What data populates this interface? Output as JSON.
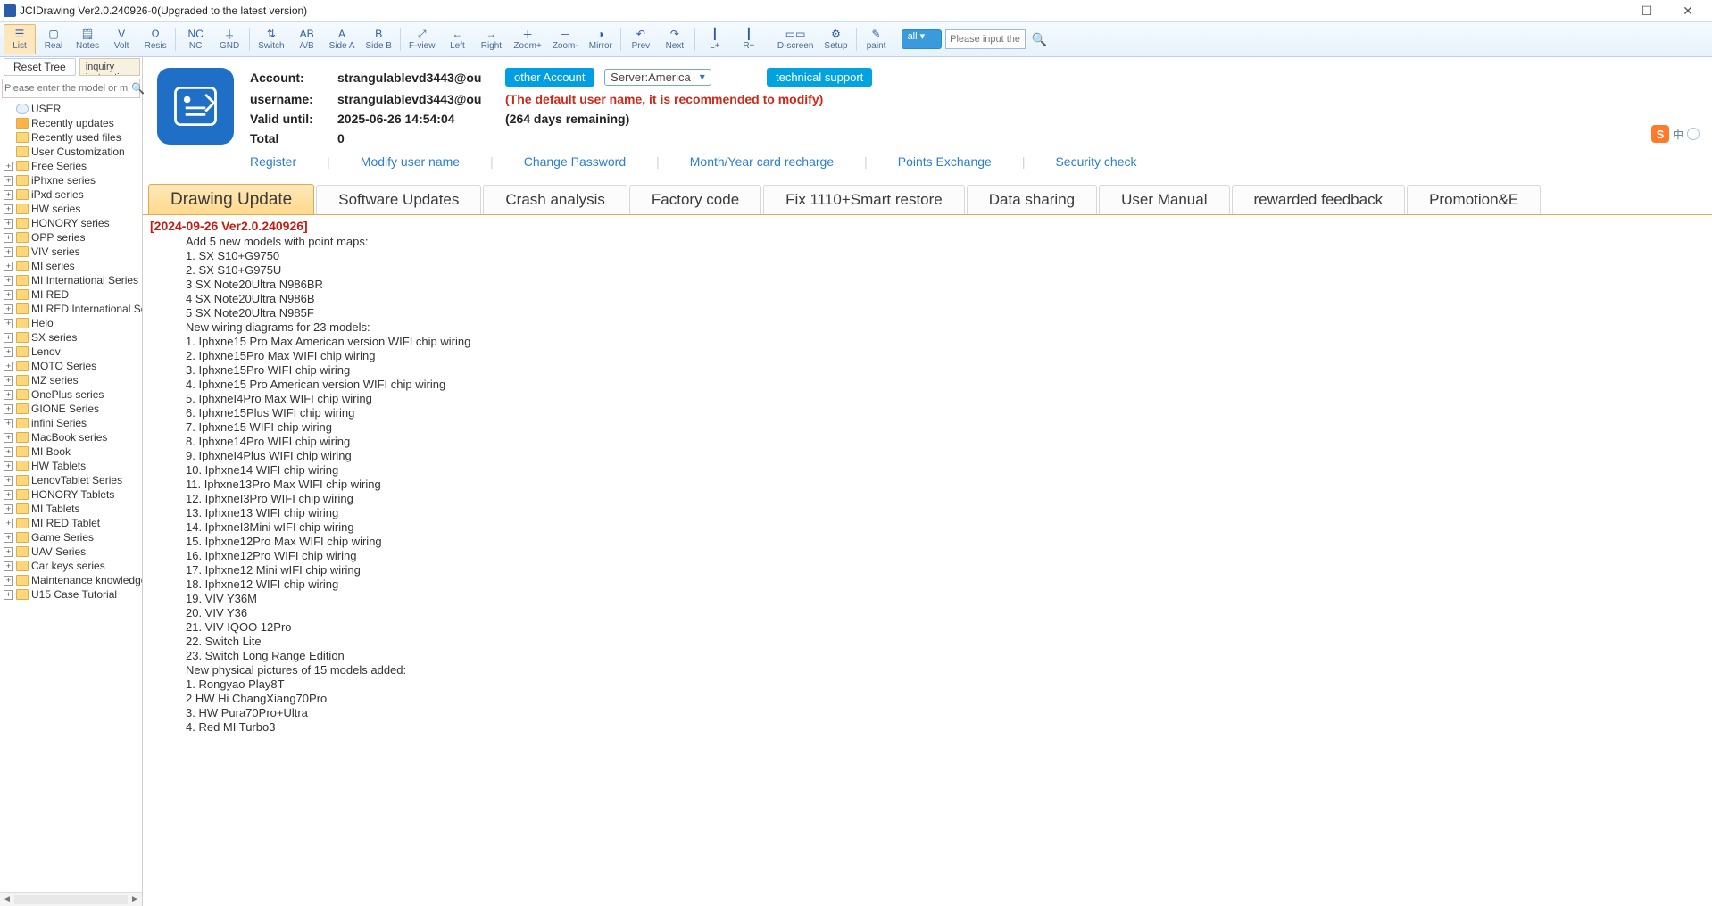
{
  "title": "JCIDrawing Ver2.0.240926-0(Upgraded to the latest version)",
  "toolbar": [
    {
      "id": "list",
      "label": "List",
      "active": true,
      "glyph": "☰"
    },
    {
      "id": "real",
      "label": "Real",
      "glyph": "▢"
    },
    {
      "id": "notes",
      "label": "Notes",
      "glyph": "🗒"
    },
    {
      "id": "volt",
      "label": "Volt",
      "glyph": "V"
    },
    {
      "id": "resis",
      "label": "Resis",
      "glyph": "Ω"
    },
    {
      "sep": true
    },
    {
      "id": "nc",
      "label": "NC",
      "glyph": "NC"
    },
    {
      "id": "gnd",
      "label": "GND",
      "glyph": "⏚"
    },
    {
      "sep": true
    },
    {
      "id": "switch",
      "label": "Switch",
      "glyph": "⇅"
    },
    {
      "id": "ab",
      "label": "A/B",
      "glyph": "AB"
    },
    {
      "id": "sidea",
      "label": "Side A",
      "glyph": "A"
    },
    {
      "id": "sideb",
      "label": "Side B",
      "glyph": "B"
    },
    {
      "sep": true
    },
    {
      "id": "fview",
      "label": "F-view",
      "glyph": "⤢"
    },
    {
      "id": "left",
      "label": "Left",
      "glyph": "←"
    },
    {
      "id": "right",
      "label": "Right",
      "glyph": "→"
    },
    {
      "id": "zoomp",
      "label": "Zoom+",
      "glyph": "＋"
    },
    {
      "id": "zoomm",
      "label": "Zoom-",
      "glyph": "－"
    },
    {
      "id": "mirror",
      "label": "Mirror",
      "glyph": "◑"
    },
    {
      "sep": true
    },
    {
      "id": "prev",
      "label": "Prev",
      "glyph": "↶"
    },
    {
      "id": "next",
      "label": "Next",
      "glyph": "↷"
    },
    {
      "sep": true
    },
    {
      "id": "lp",
      "label": "L+",
      "glyph": "┃"
    },
    {
      "id": "rp",
      "label": "R+",
      "glyph": "┃"
    },
    {
      "sep": true
    },
    {
      "id": "dscreen",
      "label": "D-screen",
      "glyph": "▭▭"
    },
    {
      "id": "setup",
      "label": "Setup",
      "glyph": "⚙"
    },
    {
      "sep": true
    },
    {
      "id": "paint",
      "label": "paint",
      "glyph": "✎"
    }
  ],
  "toolbar_search": {
    "scope": "all",
    "placeholder": "Please input the k"
  },
  "subbar": {
    "reset": "Reset Tree",
    "instructions": "Model inquiry instructions"
  },
  "tree_search_placeholder": "Please enter the model or m",
  "tree": [
    {
      "exp": "",
      "icon": "user",
      "label": "USER"
    },
    {
      "exp": "",
      "icon": "star",
      "label": "Recently updates"
    },
    {
      "exp": "",
      "icon": "folder",
      "label": "Recently used files"
    },
    {
      "exp": "",
      "icon": "folder",
      "label": "User Customization"
    },
    {
      "exp": "+",
      "icon": "folder",
      "label": "Free Series"
    },
    {
      "exp": "+",
      "icon": "folder",
      "label": "iPhxne series"
    },
    {
      "exp": "+",
      "icon": "folder",
      "label": "iPxd series"
    },
    {
      "exp": "+",
      "icon": "folder",
      "label": "HW series"
    },
    {
      "exp": "+",
      "icon": "folder",
      "label": "HONORY series"
    },
    {
      "exp": "+",
      "icon": "folder",
      "label": "OPP series"
    },
    {
      "exp": "+",
      "icon": "folder",
      "label": "VIV series"
    },
    {
      "exp": "+",
      "icon": "folder",
      "label": "MI series"
    },
    {
      "exp": "+",
      "icon": "folder",
      "label": "MI International Series"
    },
    {
      "exp": "+",
      "icon": "folder",
      "label": "MI RED"
    },
    {
      "exp": "+",
      "icon": "folder",
      "label": "MI RED International Seri"
    },
    {
      "exp": "+",
      "icon": "folder",
      "label": "Helo"
    },
    {
      "exp": "+",
      "icon": "folder",
      "label": "SX series"
    },
    {
      "exp": "+",
      "icon": "folder",
      "label": "Lenov"
    },
    {
      "exp": "+",
      "icon": "folder",
      "label": "MOTO Series"
    },
    {
      "exp": "+",
      "icon": "folder",
      "label": "MZ series"
    },
    {
      "exp": "+",
      "icon": "folder",
      "label": "OnePlus series"
    },
    {
      "exp": "+",
      "icon": "folder",
      "label": "GIONE Series"
    },
    {
      "exp": "+",
      "icon": "folder",
      "label": "infini Series"
    },
    {
      "exp": "+",
      "icon": "folder",
      "label": "MacBook series"
    },
    {
      "exp": "+",
      "icon": "folder",
      "label": "MI Book"
    },
    {
      "exp": "+",
      "icon": "folder",
      "label": "HW Tablets"
    },
    {
      "exp": "+",
      "icon": "folder",
      "label": "LenovTablet  Series"
    },
    {
      "exp": "+",
      "icon": "folder",
      "label": "HONORY Tablets"
    },
    {
      "exp": "+",
      "icon": "folder",
      "label": "MI Tablets"
    },
    {
      "exp": "+",
      "icon": "folder",
      "label": "MI RED Tablet"
    },
    {
      "exp": "+",
      "icon": "folder",
      "label": "Game Series"
    },
    {
      "exp": "+",
      "icon": "folder",
      "label": "UAV Series"
    },
    {
      "exp": "+",
      "icon": "folder",
      "label": "Car keys series"
    },
    {
      "exp": "+",
      "icon": "folder",
      "label": "Maintenance knowledge"
    },
    {
      "exp": "+",
      "icon": "folder",
      "label": "U15 Case Tutorial"
    }
  ],
  "account": {
    "k_account": "Account:",
    "v_account": "strangulablevd3443@ou",
    "other_account": "other Account",
    "server": "Server:America",
    "tech": "technical support",
    "k_user": "username:",
    "v_user": "strangulablevd3443@ou",
    "warn": "(The default user name, it is recommended to modify)",
    "k_valid": "Valid until:",
    "v_valid": "2025-06-26 14:54:04",
    "days": "(264 days remaining)",
    "k_total": "Total",
    "v_total": "0"
  },
  "links": [
    "Register",
    "Modify user name",
    "Change Password",
    "Month/Year card recharge",
    "Points Exchange",
    "Security check"
  ],
  "tabs": [
    "Drawing Update",
    "Software Updates",
    "Crash analysis",
    "Factory code",
    "Fix 1110+Smart restore",
    "Data sharing",
    "User Manual",
    "rewarded feedback",
    "Promotion&E"
  ],
  "update_header": "[2024-09-26    Ver2.0.240926]",
  "update_lines": [
    "Add 5 new models with point maps:",
    "1. SX S10+G9750",
    "2. SX S10+G975U",
    "3 SX Note20Ultra N986BR",
    "4 SX Note20Ultra N986B",
    "5 SX Note20Ultra N985F",
    "New wiring diagrams for 23 models:",
    "1. Iphxne15 Pro Max American version WIFI chip wiring",
    "2. Iphxne15Pro Max WIFI chip wiring",
    "3. Iphxne15Pro WIFI chip wiring",
    "4. Iphxne15 Pro American version WIFI chip wiring",
    "5. IphxneI4Pro Max WIFI chip wiring",
    "6. Iphxne15Plus WIFI chip wiring",
    "7. Iphxne15 WIFI chip wiring",
    "8. Iphxne14Pro WIFI chip wiring",
    "9. IphxneI4Plus WIFI chip wiring",
    "10. Iphxne14 WIFI chip wiring",
    "11. Iphxne13Pro Max WIFI chip wiring",
    "12. IphxneI3Pro WIFI chip wiring",
    "13. Iphxne13 WIFI chip wiring",
    "14. IphxneI3Mini wIFI chip wiring",
    "15. Iphxne12Pro Max WIFI chip wiring",
    "16. Iphxne12Pro WIFI chip wiring",
    "17. Iphxne12 Mini wIFI chip wiring",
    "18. Iphxne12 WIFI chip wiring",
    "19. VIV Y36M",
    "20. VIV Y36",
    "21. VIV IQOO 12Pro",
    "22. Switch Lite",
    "23. Switch Long Range Edition",
    "New physical pictures of 15 models added:",
    "1. Rongyao Play8T",
    "2 HW Hi ChangXiang70Pro",
    "3. HW Pura70Pro+Ultra",
    "4. Red MI Turbo3"
  ],
  "ime": {
    "brand": "S",
    "lang": "中"
  }
}
